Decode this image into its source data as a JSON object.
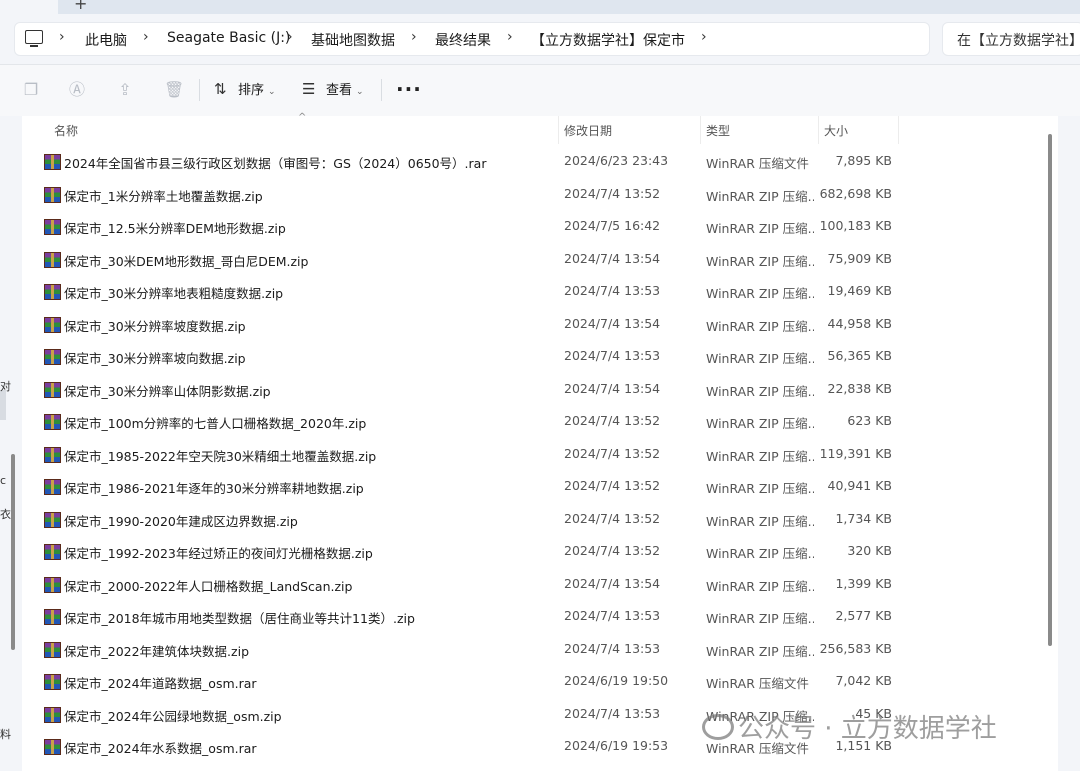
{
  "window": {
    "new_tab_label": "+"
  },
  "address_bar": {
    "breadcrumb": [
      "此电脑",
      "Seagate Basic (J:)",
      "基础地图数据",
      "最终结果",
      "【立方数据学社】保定市"
    ],
    "separator_icon": "chevron-right-icon",
    "search_placeholder": "在【立方数据学社】保..."
  },
  "toolbar": {
    "icons": [
      "copy-icon",
      "rename-icon",
      "share-icon",
      "delete-icon"
    ],
    "sort_label": "排序",
    "view_label": "查看",
    "more_label": "···"
  },
  "columns": {
    "name": "名称",
    "date": "修改日期",
    "type": "类型",
    "size": "大小"
  },
  "files": [
    {
      "name": "2024年全国省市县三级行政区划数据（审图号：GS（2024）0650号）.rar",
      "date": "2024/6/23 23:43",
      "type": "WinRAR 压缩文件",
      "size": "7,895 KB"
    },
    {
      "name": "保定市_1米分辨率土地覆盖数据.zip",
      "date": "2024/7/4 13:52",
      "type": "WinRAR ZIP 压缩...",
      "size": "682,698 KB"
    },
    {
      "name": "保定市_12.5米分辨率DEM地形数据.zip",
      "date": "2024/7/5 16:42",
      "type": "WinRAR ZIP 压缩...",
      "size": "100,183 KB"
    },
    {
      "name": "保定市_30米DEM地形数据_哥白尼DEM.zip",
      "date": "2024/7/4 13:54",
      "type": "WinRAR ZIP 压缩...",
      "size": "75,909 KB"
    },
    {
      "name": "保定市_30米分辨率地表粗糙度数据.zip",
      "date": "2024/7/4 13:53",
      "type": "WinRAR ZIP 压缩...",
      "size": "19,469 KB"
    },
    {
      "name": "保定市_30米分辨率坡度数据.zip",
      "date": "2024/7/4 13:54",
      "type": "WinRAR ZIP 压缩...",
      "size": "44,958 KB"
    },
    {
      "name": "保定市_30米分辨率坡向数据.zip",
      "date": "2024/7/4 13:53",
      "type": "WinRAR ZIP 压缩...",
      "size": "56,365 KB"
    },
    {
      "name": "保定市_30米分辨率山体阴影数据.zip",
      "date": "2024/7/4 13:54",
      "type": "WinRAR ZIP 压缩...",
      "size": "22,838 KB"
    },
    {
      "name": "保定市_100m分辨率的七普人口栅格数据_2020年.zip",
      "date": "2024/7/4 13:52",
      "type": "WinRAR ZIP 压缩...",
      "size": "623 KB"
    },
    {
      "name": "保定市_1985-2022年空天院30米精细土地覆盖数据.zip",
      "date": "2024/7/4 13:52",
      "type": "WinRAR ZIP 压缩...",
      "size": "119,391 KB"
    },
    {
      "name": "保定市_1986-2021年逐年的30米分辨率耕地数据.zip",
      "date": "2024/7/4 13:52",
      "type": "WinRAR ZIP 压缩...",
      "size": "40,941 KB"
    },
    {
      "name": "保定市_1990-2020年建成区边界数据.zip",
      "date": "2024/7/4 13:52",
      "type": "WinRAR ZIP 压缩...",
      "size": "1,734 KB"
    },
    {
      "name": "保定市_1992-2023年经过矫正的夜间灯光栅格数据.zip",
      "date": "2024/7/4 13:52",
      "type": "WinRAR ZIP 压缩...",
      "size": "320 KB"
    },
    {
      "name": "保定市_2000-2022年人口栅格数据_LandScan.zip",
      "date": "2024/7/4 13:54",
      "type": "WinRAR ZIP 压缩...",
      "size": "1,399 KB"
    },
    {
      "name": "保定市_2018年城市用地类型数据（居住商业等共计11类）.zip",
      "date": "2024/7/4 13:53",
      "type": "WinRAR ZIP 压缩...",
      "size": "2,577 KB"
    },
    {
      "name": "保定市_2022年建筑体块数据.zip",
      "date": "2024/7/4 13:53",
      "type": "WinRAR ZIP 压缩...",
      "size": "256,583 KB"
    },
    {
      "name": "保定市_2024年道路数据_osm.rar",
      "date": "2024/6/19 19:50",
      "type": "WinRAR 压缩文件",
      "size": "7,042 KB"
    },
    {
      "name": "保定市_2024年公园绿地数据_osm.zip",
      "date": "2024/7/4 13:53",
      "type": "WinRAR ZIP 压缩...",
      "size": "45 KB"
    },
    {
      "name": "保定市_2024年水系数据_osm.rar",
      "date": "2024/6/19 19:53",
      "type": "WinRAR 压缩文件",
      "size": "1,151 KB"
    }
  ],
  "nav_fragments": [
    "对",
    "c",
    "衣",
    "料"
  ],
  "watermark": "公众号 · 立方数据学社"
}
